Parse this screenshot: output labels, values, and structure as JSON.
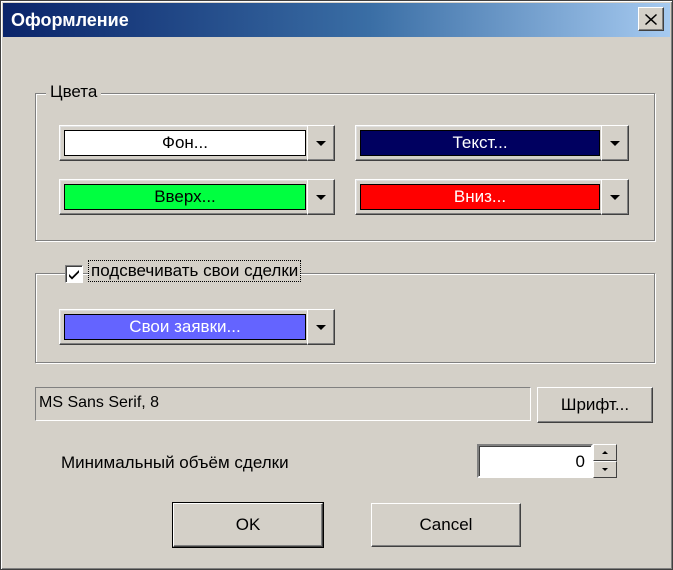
{
  "window": {
    "title": "Оформление"
  },
  "colors_group": {
    "label": "Цвета"
  },
  "colors": {
    "background": {
      "label": "Фон...",
      "swatch": "#ffffff",
      "text_color": "#000000"
    },
    "text": {
      "label": "Текст...",
      "swatch": "#000060",
      "text_color": "#ffffff"
    },
    "up": {
      "label": "Вверх...",
      "swatch": "#00ff40",
      "text_color": "#000000"
    },
    "down": {
      "label": "Вниз...",
      "swatch": "#ff0000",
      "text_color": "#ffffff"
    }
  },
  "highlight": {
    "checkbox_label": "подсвечивать свои сделки",
    "checked": true,
    "own_orders": {
      "label": "Свои заявки...",
      "swatch": "#6464ff",
      "text_color": "#ffffff"
    }
  },
  "font": {
    "value": "MS Sans Serif, 8",
    "button_label": "Шрифт..."
  },
  "min_volume": {
    "label": "Минимальный объём сделки",
    "value": "0"
  },
  "buttons": {
    "ok": "OK",
    "cancel": "Cancel"
  }
}
